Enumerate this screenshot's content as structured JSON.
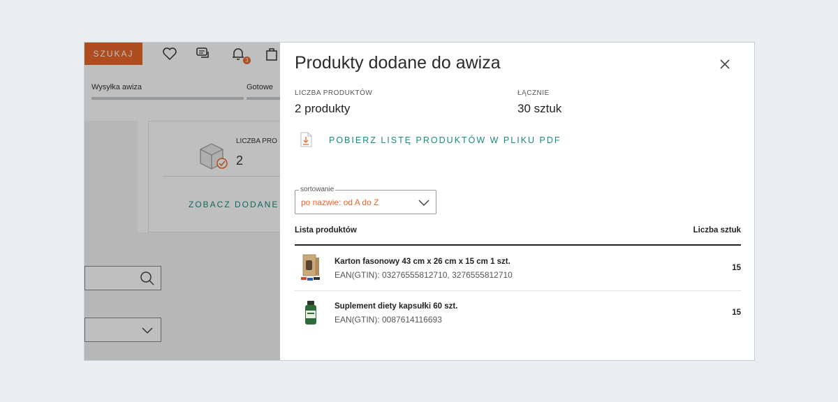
{
  "background": {
    "search_button": "SZUKAJ",
    "notification_count": "3",
    "steps": [
      "Wysyłka awiza",
      "Gotowe"
    ],
    "panel_label": "LICZBA PRO",
    "panel_value": "2",
    "panel_link": "ZOBACZ DODANE I"
  },
  "modal": {
    "title": "Produkty dodane do awiza",
    "meta": {
      "count_label": "LICZBA PRODUKTÓW",
      "count_value": "2 produkty",
      "total_label": "ŁĄCZNIE",
      "total_value": "30 sztuk"
    },
    "pdf_link": "POBIERZ LISTĘ PRODUKTÓW W PLIKU PDF",
    "sort": {
      "legend": "sortowanie",
      "value": "po nazwie: od A do Z"
    },
    "list": {
      "col_products": "Lista produktów",
      "col_qty": "Liczba sztuk",
      "items": [
        {
          "name": "Karton fasonowy 43 cm x 26 cm x 15 cm 1 szt.",
          "ean": "EAN(GTIN):  03276555812710, 3276555812710",
          "qty": "15"
        },
        {
          "name": "Suplement diety kapsułki 60 szt.",
          "ean": "EAN(GTIN):  0087614116693",
          "qty": "15"
        }
      ]
    }
  },
  "colors": {
    "accent_orange": "#e8672b",
    "link_teal": "#1a8a80"
  }
}
